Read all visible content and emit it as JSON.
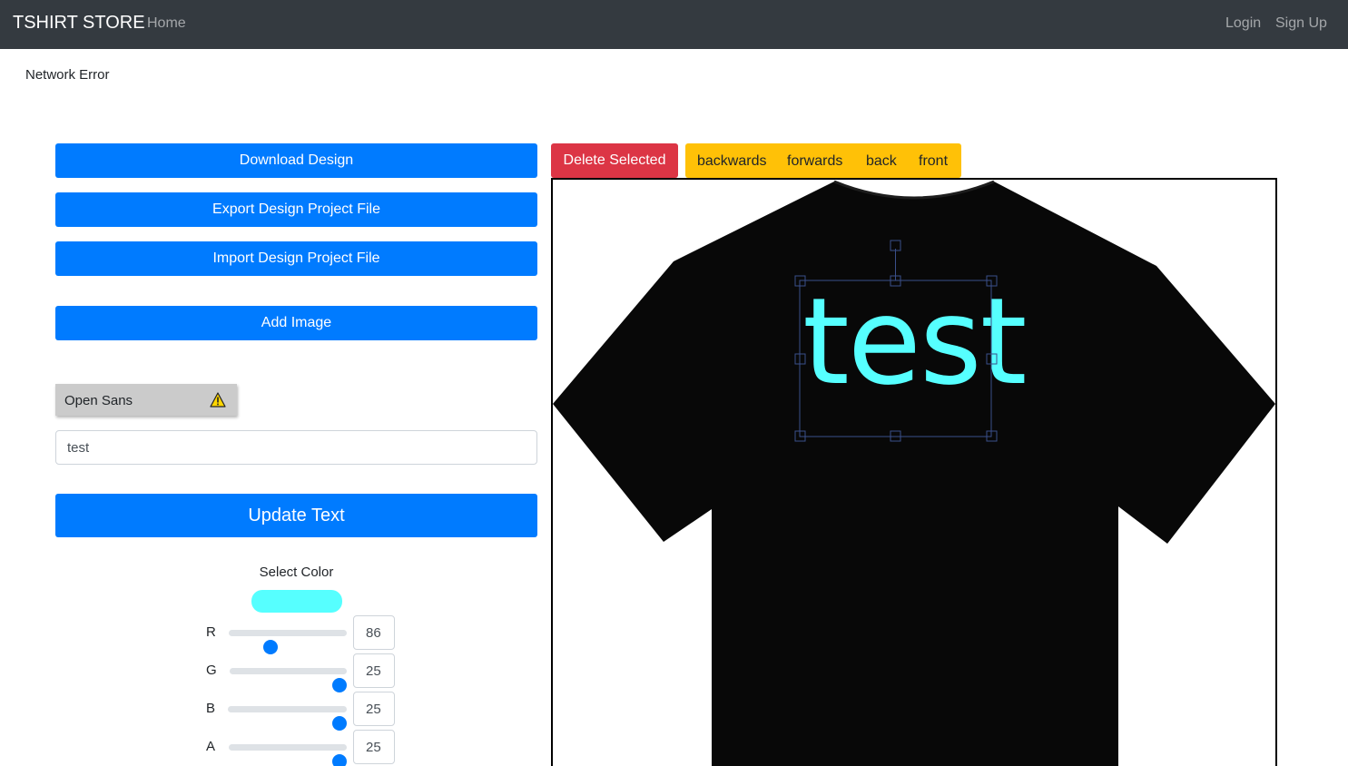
{
  "navbar": {
    "brand": "TSHIRT STORE",
    "home": "Home",
    "login": "Login",
    "signup": "Sign Up"
  },
  "error_message": "Network Error",
  "left_panel": {
    "download_label": "Download Design",
    "export_label": "Export Design Project File",
    "import_label": "Import Design Project File",
    "add_image_label": "Add Image",
    "font_name": "Open Sans",
    "font_warning_icon": "warning-triangle-icon",
    "text_value": "test",
    "update_label": "Update Text",
    "select_color_label": "Select Color",
    "selected_color": "#56ffff",
    "sliders": [
      {
        "label": "R",
        "value": 86,
        "shown": "86"
      },
      {
        "label": "G",
        "value": 255,
        "shown": "25"
      },
      {
        "label": "B",
        "value": 255,
        "shown": "25"
      },
      {
        "label": "A",
        "value": 255,
        "shown": "25"
      }
    ]
  },
  "toolbar": {
    "delete_label": "Delete Selected",
    "backwards": "backwards",
    "forwards": "forwards",
    "back": "back",
    "front": "front"
  },
  "canvas": {
    "shirt_color": "#080808",
    "design_text": "test",
    "text_color": "#56ffff",
    "selection_color": "#3a4f8a"
  },
  "colors": {
    "primary": "#007bff",
    "danger": "#dc3545",
    "warning": "#ffc107",
    "navbar": "#343a40"
  }
}
